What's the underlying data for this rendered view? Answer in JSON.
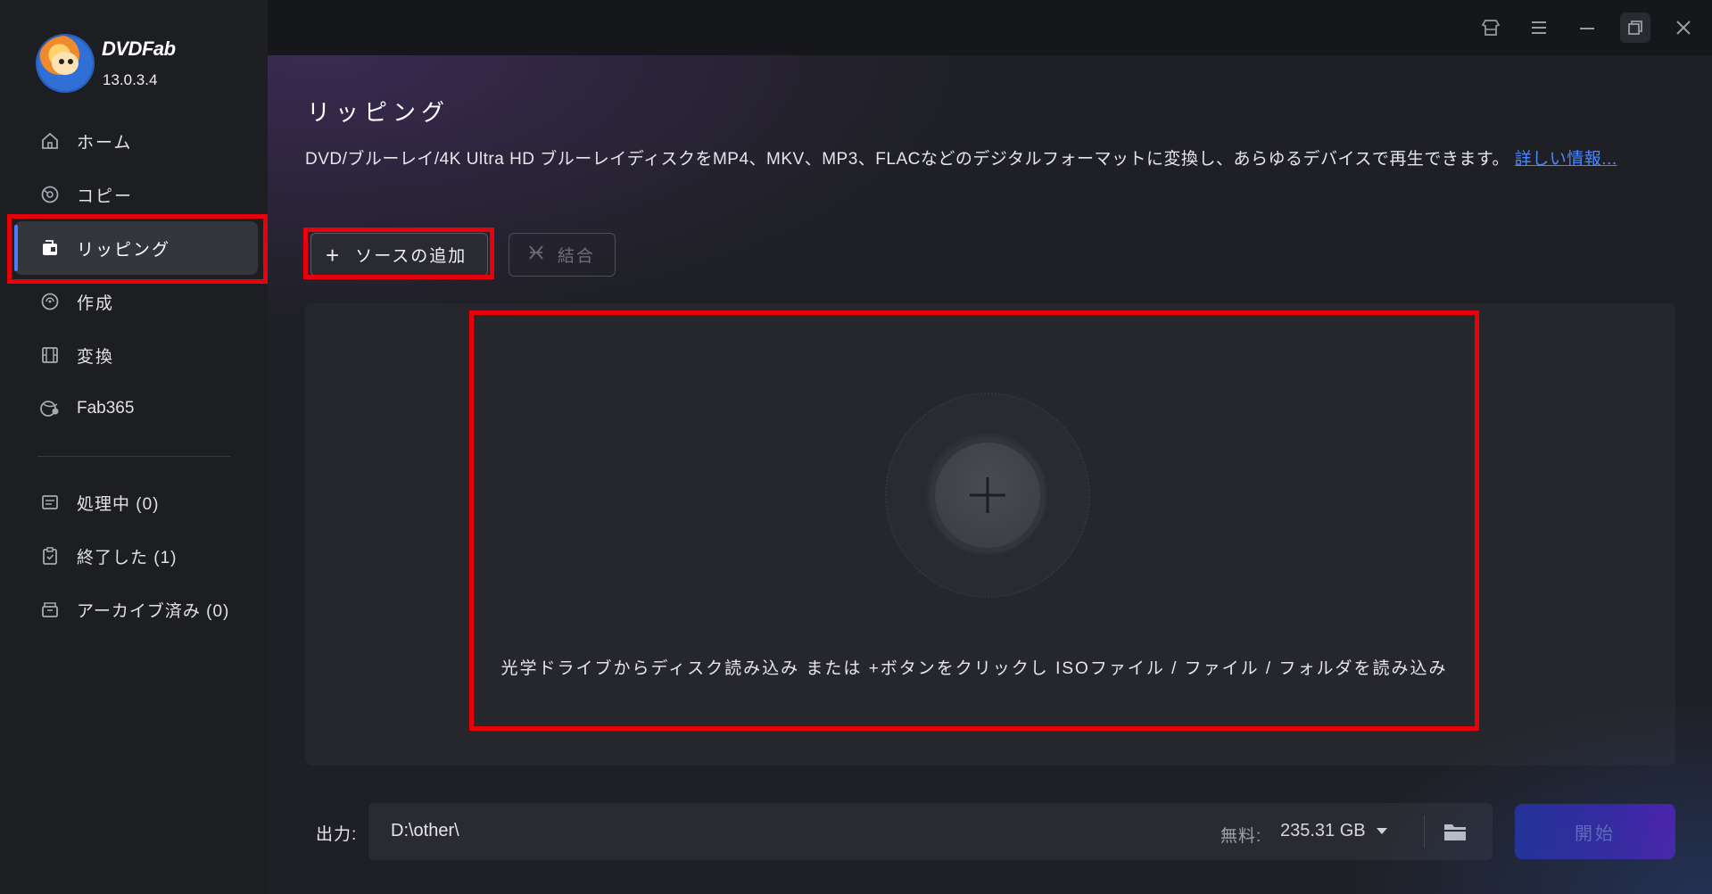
{
  "app": {
    "brand": "DVDFab",
    "version": "13.0.3.4"
  },
  "sidebar": {
    "items": [
      {
        "label": "ホーム"
      },
      {
        "label": "コピー"
      },
      {
        "label": "リッピング"
      },
      {
        "label": "作成"
      },
      {
        "label": "変換"
      },
      {
        "label": "Fab365"
      }
    ],
    "tasks": [
      {
        "label": "処理中 (0)"
      },
      {
        "label": "終了した (1)"
      },
      {
        "label": "アーカイブ済み (0)"
      }
    ]
  },
  "main": {
    "title": "リッピング",
    "description": "DVD/ブルーレイ/4K Ultra HD ブルーレイディスクをMP4、MKV、MP3、FLACなどのデジタルフォーマットに変換し、あらゆるデバイスで再生できます。",
    "more_link": "詳しい情報...",
    "add_source_label": "ソースの追加",
    "merge_label": "結合",
    "drop_hint": "光学ドライブからディスク読み込み または +ボタンをクリックし ISOファイル / ファイル / フォルダを読み込み"
  },
  "output": {
    "label": "出力:",
    "path": "D:\\other\\",
    "free_label": "無料:",
    "free_value": "235.31 GB",
    "start_label": "開始"
  },
  "icons": {
    "titlebar": [
      "skin-icon",
      "menu-icon",
      "minimize-icon",
      "restore-icon",
      "close-icon"
    ]
  },
  "colors": {
    "highlight": "#e8000b",
    "accent": "#4c7dff",
    "link": "#4a86ff"
  }
}
